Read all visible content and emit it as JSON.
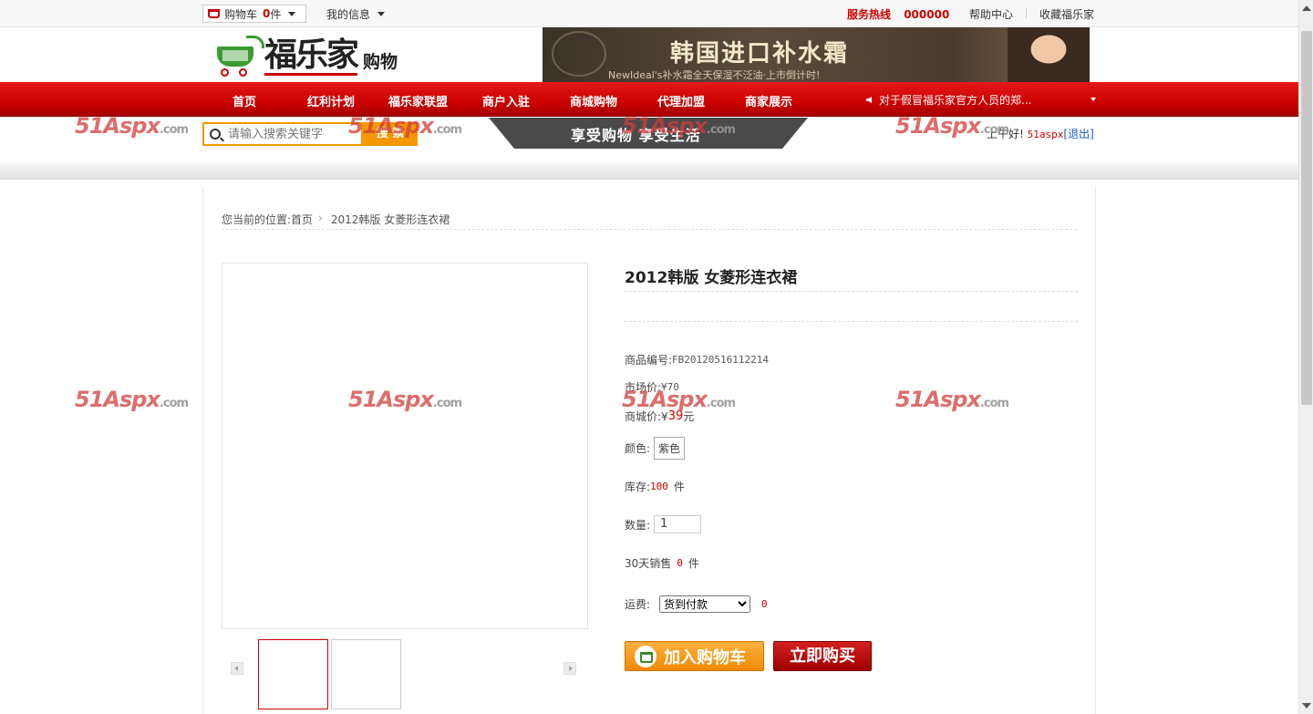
{
  "topbar": {
    "cart_label": "购物车",
    "cart_count": "0",
    "cart_unit": "件",
    "my_info": "我的信息",
    "hotline_label": "服务热线",
    "hotline_number": "000000",
    "help": "帮助中心",
    "favorite": "收藏福乐家"
  },
  "logo": {
    "brand": "福乐家",
    "suffix": "购物"
  },
  "banner": {
    "title": "韩国进口补水霜",
    "subtitle": "NewIdeal's补水霜全天保湿不泛油·上市倒计时!"
  },
  "nav": {
    "items": [
      "首页",
      "红利计划",
      "福乐家联盟",
      "商户入驻",
      "商城购物",
      "代理加盟",
      "商家展示"
    ],
    "notice": "对于假冒福乐家官方人员的郑..."
  },
  "search": {
    "placeholder": "请输入搜索关键字",
    "button": "搜 索"
  },
  "slogan": "享受购物  享受生活",
  "welcome": {
    "greeting": "上午好!",
    "user": "51aspx",
    "logout": "[退出]"
  },
  "breadcrumb": {
    "prefix": "您当前的位置:",
    "home": "首页",
    "current": "2012韩版 女菱形连衣裙"
  },
  "product": {
    "title": "2012韩版 女菱形连衣裙",
    "code_label": "商品编号:",
    "code": "FB20120516112214",
    "market_price_label": "市场价:",
    "market_price": "¥70",
    "mall_price_label": "商城价:",
    "mall_price_symbol": "¥",
    "mall_price": "39",
    "mall_price_unit": "元",
    "color_label": "颜色:",
    "color": "紫色",
    "stock_label": "库存:",
    "stock": "100",
    "stock_unit": "件",
    "qty_label": "数量:",
    "qty": "1",
    "sales_label": "30天销售",
    "sales": "0",
    "sales_unit": "件",
    "shipping_label": "运费:",
    "shipping_option": "货到付款",
    "shipping_fee": "0",
    "add_to_cart": "加入购物车",
    "buy_now": "立即购买"
  },
  "watermark": {
    "main": "51Aspx",
    "suffix": ".com"
  }
}
